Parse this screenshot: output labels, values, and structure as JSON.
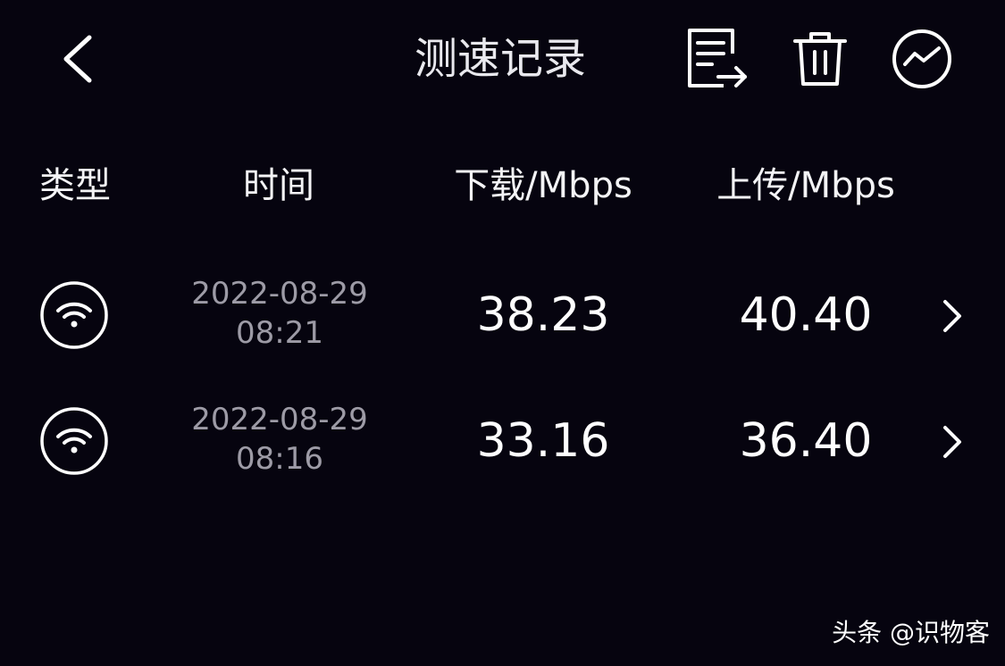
{
  "header": {
    "title": "测速记录",
    "back_icon": "chevron-left-icon",
    "actions": [
      {
        "name": "export",
        "icon": "export-document-icon"
      },
      {
        "name": "delete",
        "icon": "trash-icon"
      },
      {
        "name": "trend",
        "icon": "line-chart-circle-icon"
      }
    ]
  },
  "columns": {
    "type": "类型",
    "time": "时间",
    "download": "下载/Mbps",
    "upload": "上传/Mbps"
  },
  "records": [
    {
      "type_icon": "wifi-icon",
      "date": "2022-08-29",
      "time": "08:21",
      "download": "38.23",
      "upload": "40.40"
    },
    {
      "type_icon": "wifi-icon",
      "date": "2022-08-29",
      "time": "08:16",
      "download": "33.16",
      "upload": "36.40"
    }
  ],
  "watermark": "头条 @识物客",
  "colors": {
    "background": "#06040f",
    "text_primary": "#ffffff",
    "text_secondary": "#9d9ba6"
  }
}
